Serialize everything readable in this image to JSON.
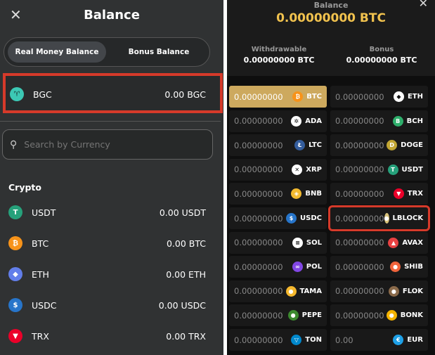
{
  "left": {
    "title": "Balance",
    "tabs": [
      "Real Money Balance",
      "Bonus Balance"
    ],
    "featured": {
      "symbol": "BGC",
      "amount": "0.00 BGC",
      "color": "#3cc8b4"
    },
    "search_placeholder": "Search by Currency",
    "section": "Crypto",
    "items": [
      {
        "symbol": "USDT",
        "amount": "0.00 USDT",
        "color": "#26a17b",
        "glyph": "T"
      },
      {
        "symbol": "BTC",
        "amount": "0.00 BTC",
        "color": "#f7931a",
        "glyph": "₿"
      },
      {
        "symbol": "ETH",
        "amount": "0.00 ETH",
        "color": "#627eea",
        "glyph": "◆"
      },
      {
        "symbol": "USDC",
        "amount": "0.00 USDC",
        "color": "#2775ca",
        "glyph": "$"
      },
      {
        "symbol": "TRX",
        "amount": "0.00 TRX",
        "color": "#eb0029",
        "glyph": "▼"
      }
    ]
  },
  "right": {
    "label": "Balance",
    "total": "0.00000000 BTC",
    "withdrawable_label": "Withdrawable",
    "withdrawable": "0.00000000 BTC",
    "bonus_label": "Bonus",
    "bonus": "0.00000000 BTC",
    "cells": [
      {
        "amount": "0.00000000",
        "symbol": "BTC",
        "color": "#f7931a",
        "glyph": "₿"
      },
      {
        "amount": "0.00000000",
        "symbol": "ETH",
        "color": "#ffffff",
        "glyph": "◆"
      },
      {
        "amount": "0.00000000",
        "symbol": "ADA",
        "color": "#ffffff",
        "glyph": "✲"
      },
      {
        "amount": "0.00000000",
        "symbol": "BCH",
        "color": "#2eae6b",
        "glyph": "B"
      },
      {
        "amount": "0.00000000",
        "symbol": "LTC",
        "color": "#345d9d",
        "glyph": "Ł"
      },
      {
        "amount": "0.00000000",
        "symbol": "DOGE",
        "color": "#c2a633",
        "glyph": "D"
      },
      {
        "amount": "0.00000000",
        "symbol": "XRP",
        "color": "#ffffff",
        "glyph": "✕"
      },
      {
        "amount": "0.00000000",
        "symbol": "USDT",
        "color": "#26a17b",
        "glyph": "T"
      },
      {
        "amount": "0.00000000",
        "symbol": "BNB",
        "color": "#f3ba2f",
        "glyph": "◈"
      },
      {
        "amount": "0.00000000",
        "symbol": "TRX",
        "color": "#eb0029",
        "glyph": "▼"
      },
      {
        "amount": "0.00000000",
        "symbol": "USDC",
        "color": "#2775ca",
        "glyph": "$"
      },
      {
        "amount": "0.00000000",
        "symbol": "LBLOCK",
        "color": "#d8c27a",
        "glyph": "●"
      },
      {
        "amount": "0.00000000",
        "symbol": "SOL",
        "color": "#ffffff",
        "glyph": "≡"
      },
      {
        "amount": "0.00000000",
        "symbol": "AVAX",
        "color": "#e84142",
        "glyph": "▲"
      },
      {
        "amount": "0.00000000",
        "symbol": "POL",
        "color": "#8247e5",
        "glyph": "∞"
      },
      {
        "amount": "0.00000000",
        "symbol": "SHIB",
        "color": "#f0643c",
        "glyph": "●"
      },
      {
        "amount": "0.00000000",
        "symbol": "TAMA",
        "color": "#f5b82e",
        "glyph": "●"
      },
      {
        "amount": "0.00000000",
        "symbol": "FLOK",
        "color": "#8a6a4a",
        "glyph": "●"
      },
      {
        "amount": "0.00000000",
        "symbol": "PEPE",
        "color": "#3c8a2e",
        "glyph": "●"
      },
      {
        "amount": "0.00000000",
        "symbol": "BONK",
        "color": "#f5b400",
        "glyph": "●"
      },
      {
        "amount": "0.00000000",
        "symbol": "TON",
        "color": "#0088cc",
        "glyph": "▽"
      },
      {
        "amount": "0.00",
        "symbol": "EUR",
        "color": "#1ea0e6",
        "glyph": "€"
      }
    ]
  }
}
